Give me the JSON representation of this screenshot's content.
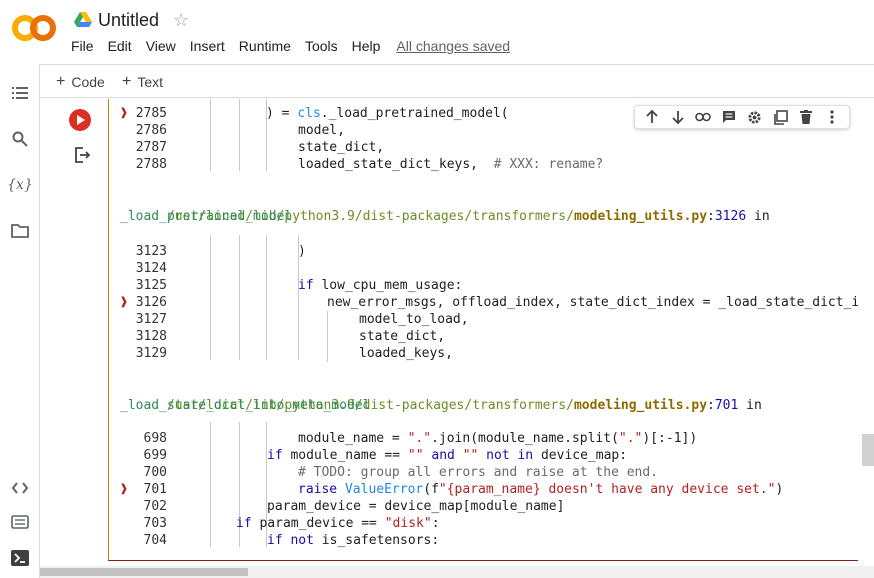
{
  "app": {
    "doc_title": "Untitled",
    "star_icon": "star-icon",
    "logo_text": "CO"
  },
  "menu": {
    "items": [
      "File",
      "Edit",
      "View",
      "Insert",
      "Runtime",
      "Tools",
      "Help"
    ],
    "saved_status": "All changes saved"
  },
  "toolbar": {
    "add_code": "Code",
    "add_text": "Text"
  },
  "rail": {
    "icons": [
      "toc-icon",
      "search-icon",
      "variables-icon",
      "folder-icon",
      "code-snippets-icon",
      "command-palette-icon",
      "terminal-icon"
    ],
    "variables_label": "{x}"
  },
  "cell_tools": [
    "move-up-icon",
    "move-down-icon",
    "link-icon",
    "comment-icon",
    "settings-icon",
    "mirror-cell-icon",
    "delete-icon",
    "more-icon"
  ],
  "output": {
    "block1": [
      {
        "n": "2785",
        "mark": true,
        "code": ") = cls._load_pretrained_model("
      },
      {
        "n": "2786",
        "mark": false,
        "code": "model,"
      },
      {
        "n": "2787",
        "mark": false,
        "code": "state_dict,"
      },
      {
        "n": "2788",
        "mark": false,
        "code": "loaded_state_dict_keys,  # XXX: rename?"
      }
    ],
    "trace1": {
      "path": "/usr/local/lib/python3.9/dist-packages/transformers/",
      "file": "modeling_utils.py",
      "lineno": "3126",
      "in": " in",
      "func": "_load_pretrained_model"
    },
    "block2": [
      {
        "n": "3123",
        "mark": false,
        "code": ")"
      },
      {
        "n": "3124",
        "mark": false,
        "code": ""
      },
      {
        "n": "3125",
        "mark": false,
        "code": "if low_cpu_mem_usage:"
      },
      {
        "n": "3126",
        "mark": true,
        "code": "new_error_msgs, offload_index, state_dict_index = _load_state_dict_i"
      },
      {
        "n": "3127",
        "mark": false,
        "code": "model_to_load,"
      },
      {
        "n": "3128",
        "mark": false,
        "code": "state_dict,"
      },
      {
        "n": "3129",
        "mark": false,
        "code": "loaded_keys,"
      }
    ],
    "trace2": {
      "path": "/usr/local/lib/python3.9/dist-packages/transformers/",
      "file": "modeling_utils.py",
      "lineno": "701",
      "in": " in",
      "func": "_load_state_dict_into_meta_model"
    },
    "block3": [
      {
        "n": "698",
        "mark": false,
        "code": "module_name = \".\".join(module_name.split(\".\")[:-1])"
      },
      {
        "n": "699",
        "mark": false,
        "code": "if module_name == \"\" and \"\" not in device_map:"
      },
      {
        "n": "700",
        "mark": false,
        "code": "# TODO: group all errors and raise at the end."
      },
      {
        "n": "701",
        "mark": true,
        "code": "raise ValueError(f\"{param_name} doesn't have any device set.\")"
      },
      {
        "n": "702",
        "mark": false,
        "code": "param_device = device_map[module_name]"
      },
      {
        "n": "703",
        "mark": false,
        "code": "if param_device == \"disk\":"
      },
      {
        "n": "704",
        "mark": false,
        "code": "if not is_safetensors:"
      }
    ]
  }
}
